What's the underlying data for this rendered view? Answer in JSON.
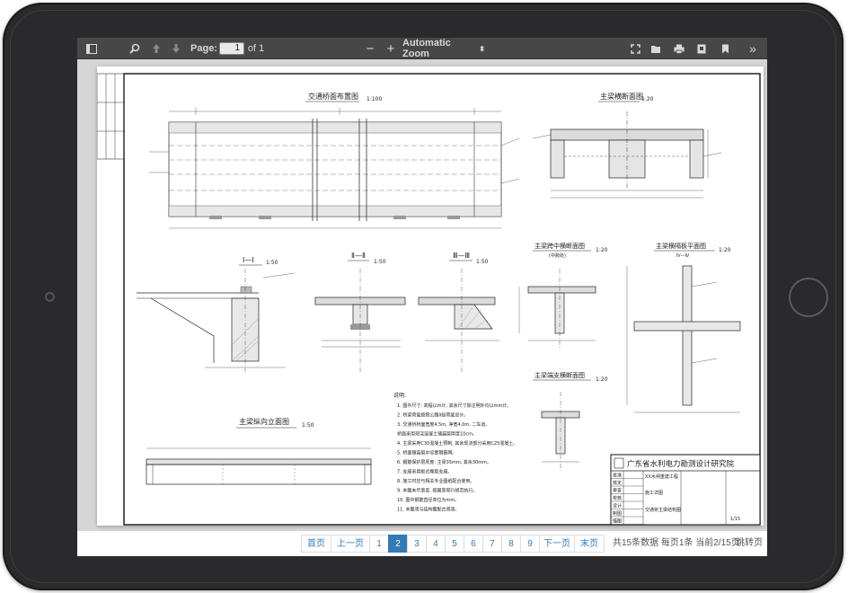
{
  "viewer": {
    "page_label": "Page:",
    "page_value": "1",
    "page_count": "of 1",
    "zoom_label": "Automatic Zoom"
  },
  "drawing": {
    "title_plan": "交通桥面布置图",
    "scale_plan": "1:100",
    "title_section_main": "主梁横断面图",
    "scale_section_main": "1:20",
    "title_1": "Ⅰ—Ⅰ",
    "scale_1": "1:50",
    "title_2": "Ⅱ—Ⅱ",
    "scale_2": "1:50",
    "title_3": "Ⅲ—Ⅲ",
    "scale_3": "1:50",
    "title_beam_span": "主梁跨中横断面图",
    "scale_beam_span": "1:20",
    "title_beam_span_sub": "(中跨处)",
    "title_cross_beam": "主梁横隔板平面图",
    "scale_cross_beam": "1:20",
    "title_cross_beam_sub": "Ⅳ—Ⅳ",
    "title_beam_end": "主梁端支横断面图",
    "scale_beam_end": "1:20",
    "title_long": "主梁纵向立面图",
    "scale_long": "1:50",
    "notes_heading": "说明:",
    "notes": [
      "1. 图中尺寸: 高程以m计, 其余尺寸除注明外均以mm计。",
      "2. 桥梁荷载按照公路II级荷载设计。",
      "3. 交通桥桥面宽度4.5m, 净宽4.0m, 二车道。",
      "桥面采用现浇混凝土铺装层厚度10cm。",
      "4. 主梁采用C30混凝土预制, 其余现浇部分采用C25混凝土。",
      "5. 桥面铺装层中设置钢筋网。",
      "6. 钢筋保护层厚度: 主梁35mm, 其余30mm。",
      "7. 支座采用板式橡胶支座。",
      "8. 施工时应与相关专业图纸配合使用。",
      "9. 本图未尽事宜, 按国家现行规范执行。",
      "10. 图中钢筋直径单位为mm。",
      "11. 本图须与结构图配合阅读。"
    ],
    "company": "广东省水利电力勘测设计研究院",
    "tb_labels": [
      "批准",
      "核定",
      "审查",
      "校核",
      "设计",
      "制图",
      "描图"
    ],
    "tb_project": "XX水闸重建工程",
    "tb_stage": "施工详图",
    "tb_drawing_name": "交通桥主梁结构图",
    "tb_number": "1/15"
  },
  "pager": {
    "first": "首页",
    "prev": "上一页",
    "pages": [
      "1",
      "2",
      "3",
      "4",
      "5",
      "6",
      "7",
      "8",
      "9"
    ],
    "active_page": "2",
    "next": "下一页",
    "last": "末页",
    "info": "共15条数据 每页1条 当前2/15页",
    "jump": "跳转页"
  }
}
